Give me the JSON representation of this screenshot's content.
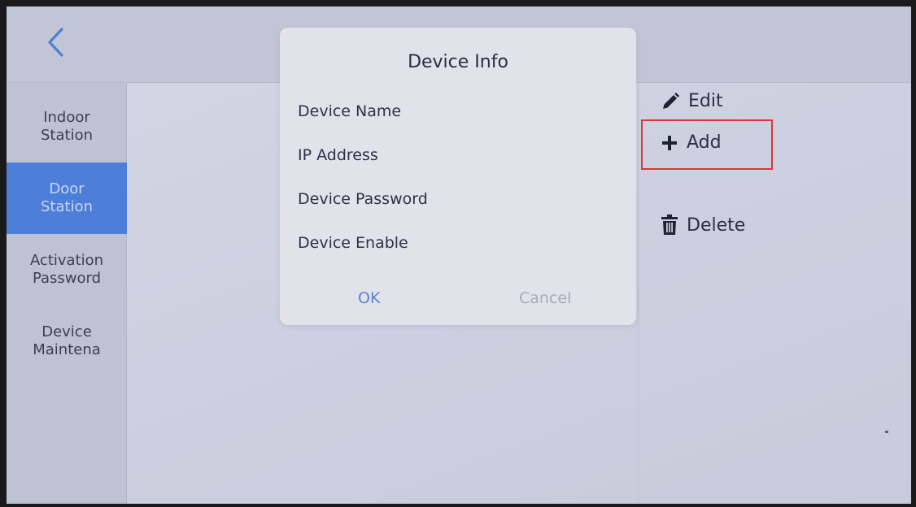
{
  "sidebar": {
    "items": [
      {
        "label": "Indoor\nStation",
        "active": false
      },
      {
        "label": "Door\nStation",
        "active": true
      },
      {
        "label": "Activation\nPassword",
        "active": false
      },
      {
        "label": "Device\nMaintena",
        "active": false
      }
    ]
  },
  "actions": {
    "edit": {
      "label": "Edit",
      "icon": "pencil-icon"
    },
    "add": {
      "label": "Add",
      "icon": "plus-icon"
    },
    "delete": {
      "label": "Delete",
      "icon": "trash-icon"
    }
  },
  "dialog": {
    "title": "Device Info",
    "fields": [
      "Device Name",
      "IP Address",
      "Device Password",
      "Device Enable"
    ],
    "ok_label": "OK",
    "cancel_label": "Cancel"
  },
  "colors": {
    "active_tab": "#4d7fd8",
    "highlight": "#e03438",
    "ok_text": "#5b86d4",
    "back_arrow": "#4f7fd6"
  }
}
